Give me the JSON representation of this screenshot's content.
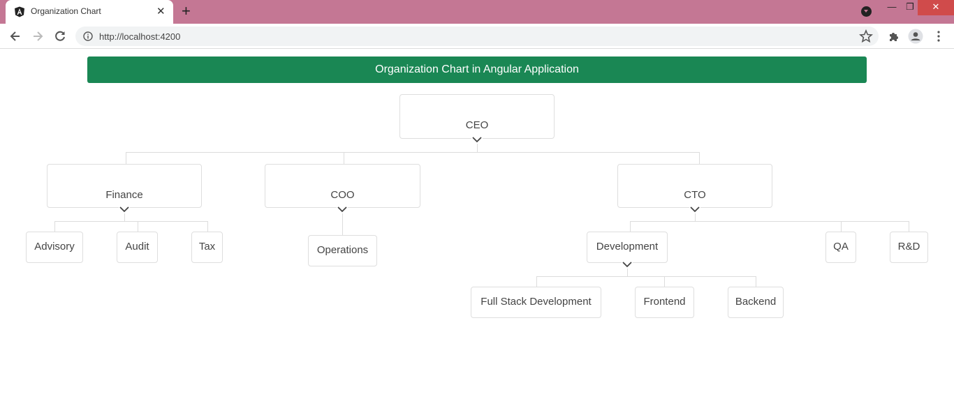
{
  "browser": {
    "tab_title": "Organization Chart",
    "url": "http://localhost:4200",
    "icons": {
      "tab": "angular-icon",
      "close": "close-icon",
      "new_tab": "plus-icon",
      "back": "arrow-left-icon",
      "forward": "arrow-right-icon",
      "reload": "reload-icon",
      "info": "info-icon",
      "star": "star-icon",
      "extensions": "puzzle-icon",
      "profile": "person-icon",
      "menu": "kebab-menu-icon"
    },
    "tab_close_glyph": "✕",
    "new_tab_glyph": "+",
    "window": {
      "minimize": "—",
      "restore": "❐",
      "close": "✕"
    }
  },
  "page": {
    "banner_title": "Organization Chart in Angular Application",
    "banner_color": "#1a8754"
  },
  "org": {
    "root": "CEO",
    "level1": [
      "Finance",
      "COO",
      "CTO"
    ],
    "finance_children": [
      "Advisory",
      "Audit",
      "Tax"
    ],
    "coo_children": [
      "Operations"
    ],
    "cto_children": [
      "Development",
      "QA",
      "R&D"
    ],
    "development_children": [
      "Full Stack Development",
      "Frontend",
      "Backend"
    ]
  }
}
